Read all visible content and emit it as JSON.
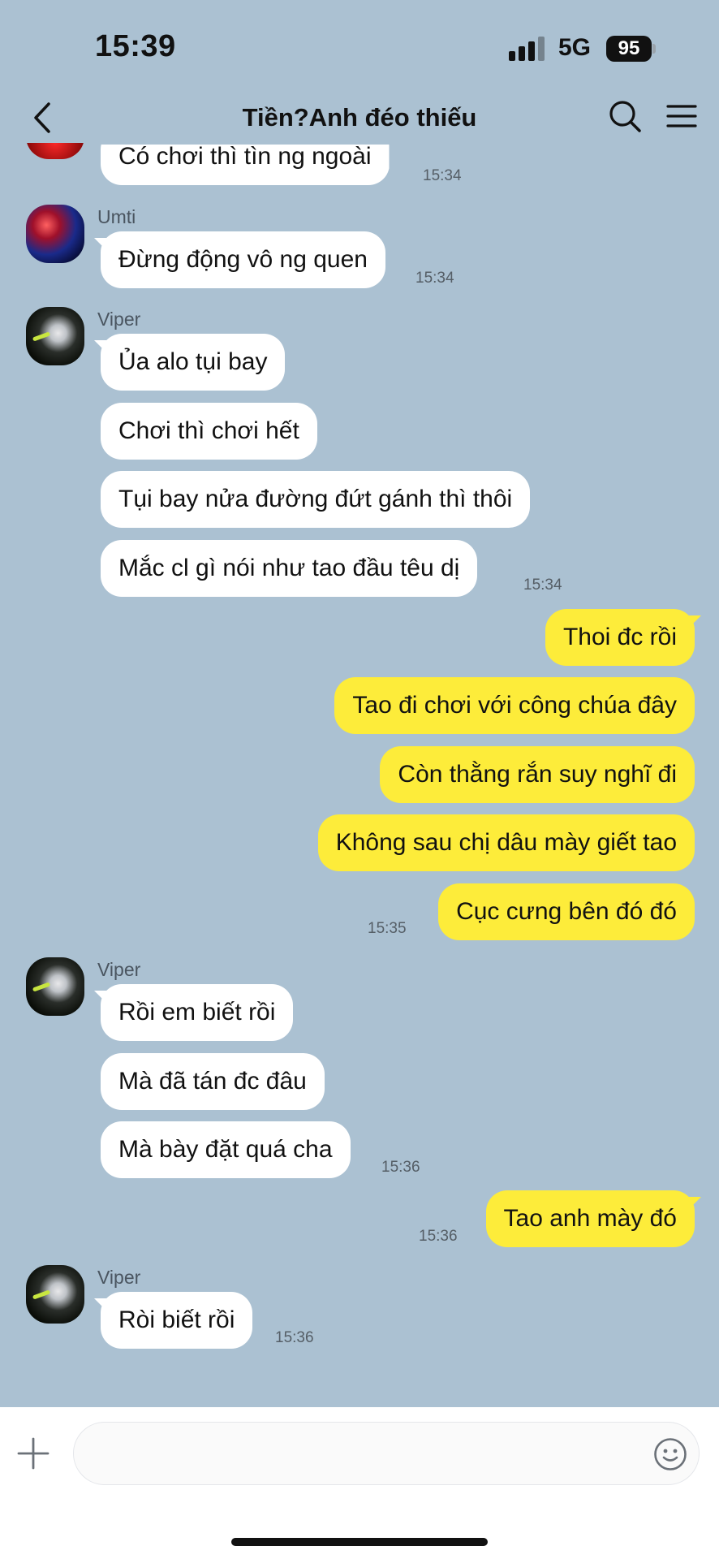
{
  "status_bar": {
    "time": "15:39",
    "network": "5G",
    "battery": "95"
  },
  "header": {
    "title": "Tiền?Anh đéo thiếu"
  },
  "messages": {
    "m0": {
      "text": "Có chơi thì tìn ng ngoài",
      "time": "15:34"
    },
    "m1": {
      "sender": "Umti",
      "text": "Đừng động vô ng quen",
      "time": "15:34"
    },
    "g1": {
      "sender": "Viper",
      "texts": [
        "Ủa alo tụi bay",
        "Chơi thì chơi hết",
        "Tụi bay nửa đường đứt gánh thì thôi",
        "Mắc cl gì nói như tao đầu têu dị"
      ],
      "time": "15:34"
    },
    "g2": {
      "texts": [
        "Thoi đc rồi",
        "Tao đi chơi với công chúa đây",
        "Còn thằng rắn suy nghĩ đi",
        "Không sau chị dâu mày giết tao",
        "Cục cưng bên đó đó"
      ],
      "time": "15:35"
    },
    "g3": {
      "sender": "Viper",
      "texts": [
        "Rồi em biết rồi",
        "Mà đã tán đc đâu",
        "Mà bày đặt quá cha"
      ],
      "time": "15:36"
    },
    "g4": {
      "texts": [
        "Tao anh mày đó"
      ],
      "time": "15:36"
    },
    "g5": {
      "sender": "Viper",
      "texts": [
        "Ròi biết rồi"
      ],
      "time": "15:36"
    }
  },
  "input": {
    "placeholder": ""
  },
  "icons": {
    "back": "chevron-left-icon",
    "search": "search-icon",
    "menu": "hamburger-menu-icon",
    "plus": "plus-icon",
    "emoji": "smiley-icon"
  },
  "colors": {
    "background": "#abc1d2",
    "incoming_bubble": "#ffffff",
    "outgoing_bubble": "#fdec3a"
  }
}
